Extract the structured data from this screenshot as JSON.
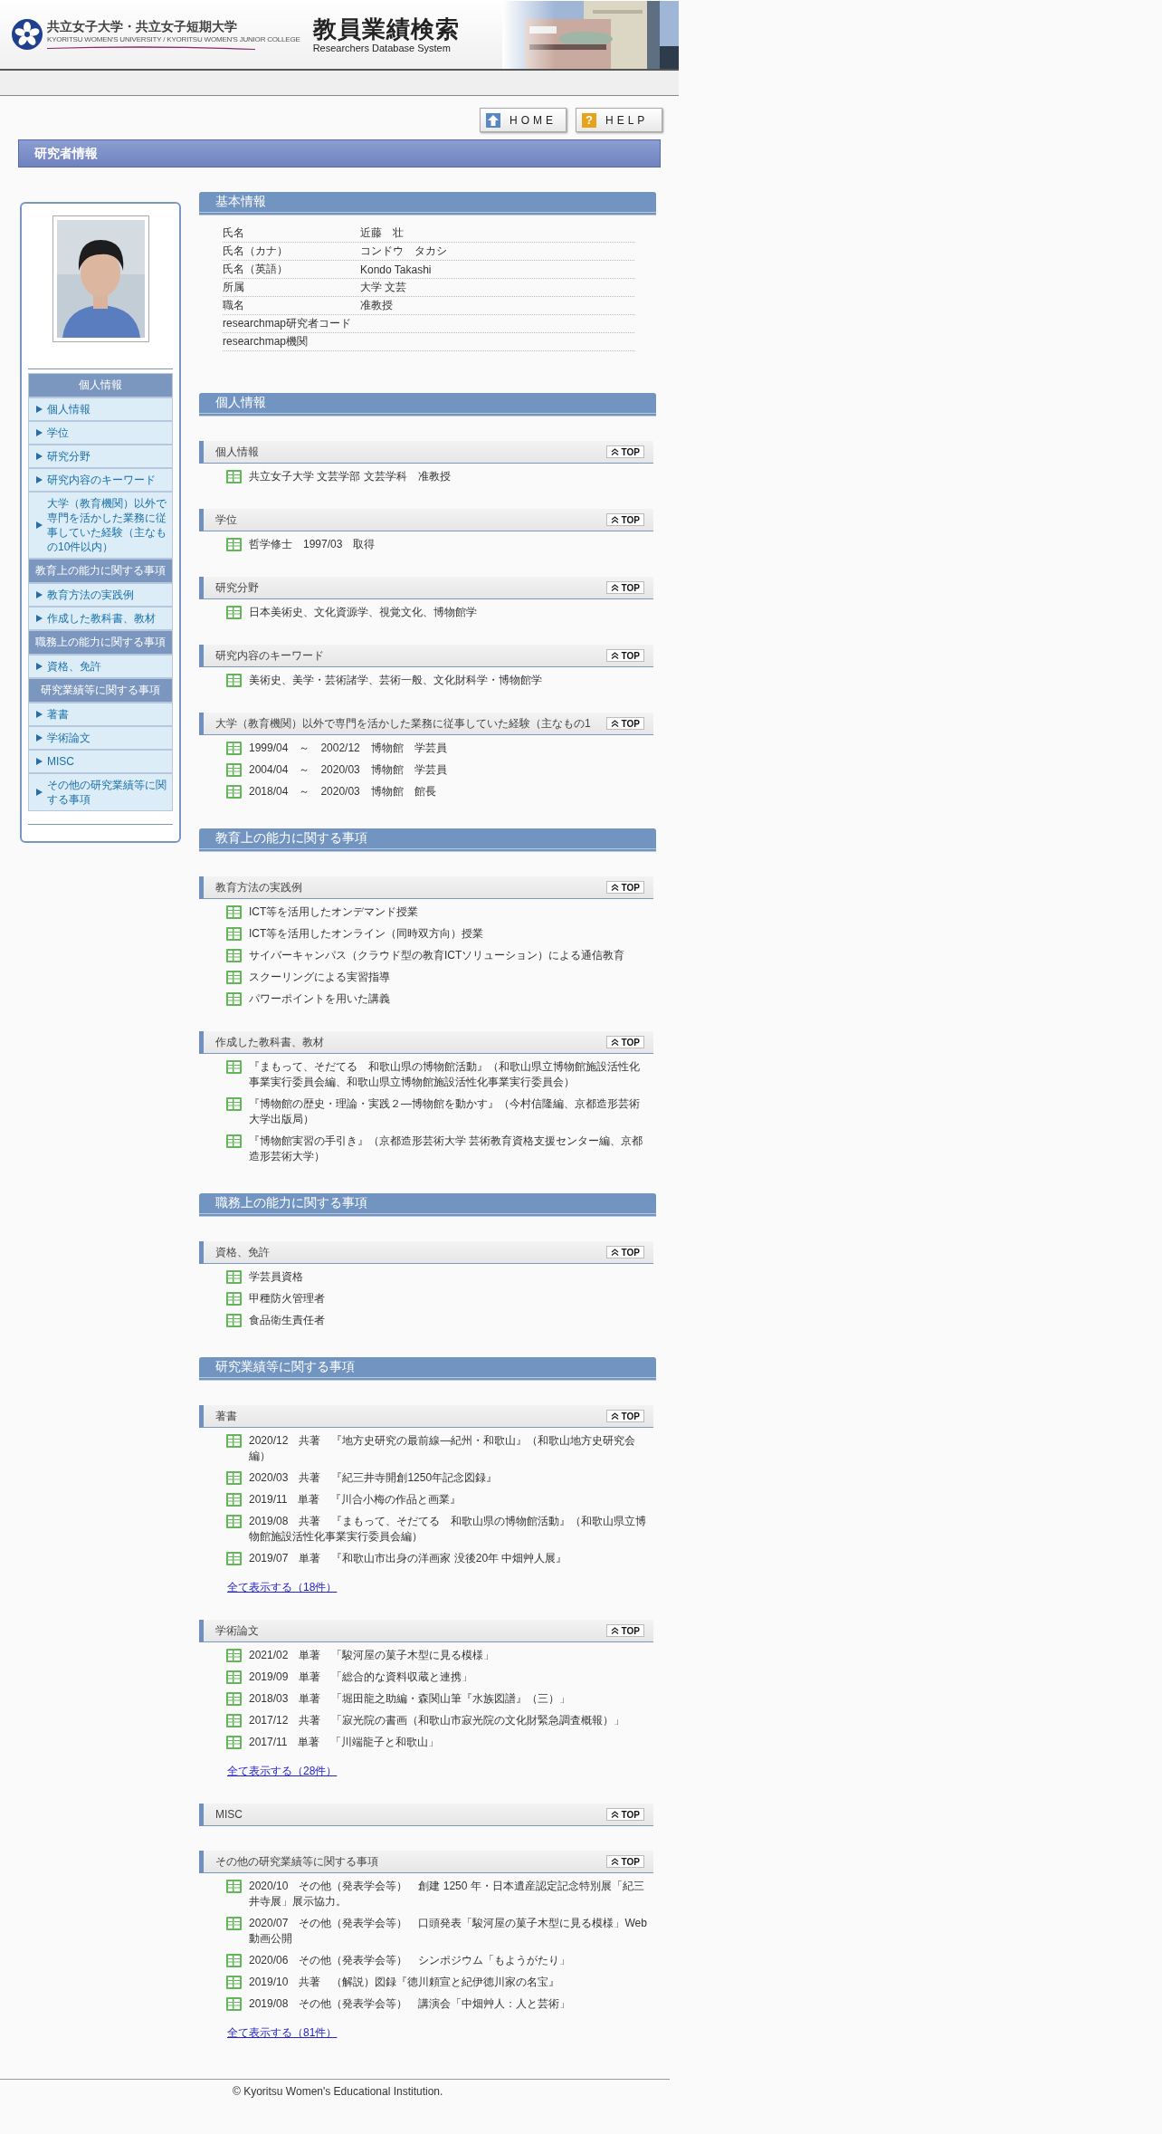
{
  "header": {
    "logo_jp": "共立女子大学・共立女子短期大学",
    "logo_en": "KYORITSU WOMEN'S UNIVERSITY / KYORITSU WOMEN'S JUNIOR COLLEGE",
    "title": "教員業績検索",
    "subtitle": "Researchers Database System"
  },
  "nav_buttons": [
    {
      "kind": "home",
      "label": "HOME"
    },
    {
      "kind": "help",
      "label": "HELP",
      "icon": "?"
    }
  ],
  "page_title": "研究者情報",
  "sidebar": {
    "menu": [
      {
        "kind": "heading",
        "label": "個人情報"
      },
      {
        "kind": "link",
        "label": "個人情報"
      },
      {
        "kind": "link",
        "label": "学位"
      },
      {
        "kind": "link",
        "label": "研究分野"
      },
      {
        "kind": "link",
        "label": "研究内容のキーワード"
      },
      {
        "kind": "link",
        "label": "大学（教育機関）以外で専門を活かした業務に従事していた経験（主なもの10件以内）"
      },
      {
        "kind": "heading",
        "label": "教育上の能力に関する事項"
      },
      {
        "kind": "link",
        "label": "教育方法の実践例"
      },
      {
        "kind": "link",
        "label": "作成した教科書、教材"
      },
      {
        "kind": "heading",
        "label": "職務上の能力に関する事項"
      },
      {
        "kind": "link",
        "label": "資格、免許"
      },
      {
        "kind": "heading",
        "label": "研究業績等に関する事項"
      },
      {
        "kind": "link",
        "label": "著書"
      },
      {
        "kind": "link",
        "label": "学術論文"
      },
      {
        "kind": "link",
        "label": "MISC"
      },
      {
        "kind": "link",
        "label": "その他の研究業績等に関する事項"
      }
    ]
  },
  "basic_info": {
    "title": "基本情報",
    "rows": [
      {
        "label": "氏名",
        "value": "近藤　壮"
      },
      {
        "label": "氏名（カナ）",
        "value": "コンドウ　タカシ"
      },
      {
        "label": "氏名（英語）",
        "value": "Kondo Takashi"
      },
      {
        "label": "所属",
        "value": "大学 文芸"
      },
      {
        "label": "職名",
        "value": "准教授"
      },
      {
        "label": "researchmap研究者コード"
      },
      {
        "label": "researchmap機関"
      }
    ]
  },
  "sections": [
    {
      "title": "個人情報",
      "subsections": [
        {
          "title": "個人情報",
          "top": "TOP",
          "items": [
            "共立女子大学 文芸学部 文芸学科　准教授"
          ]
        },
        {
          "title": "学位",
          "top": "TOP",
          "items": [
            "哲学修士　1997/03　取得"
          ]
        },
        {
          "title": "研究分野",
          "top": "TOP",
          "items": [
            "日本美術史、文化資源学、視覚文化、博物館学"
          ]
        },
        {
          "title": "研究内容のキーワード",
          "top": "TOP",
          "items": [
            "美術史、美学・芸術諸学、芸術一般、文化財科学・博物館学"
          ]
        },
        {
          "title": "大学（教育機関）以外で専門を活かした業務に従事していた経験（主なもの1",
          "top": "TOP",
          "items": [
            "1999/04　～　2002/12　博物館　学芸員",
            "2004/04　～　2020/03　博物館　学芸員",
            "2018/04　～　2020/03　博物館　館長"
          ]
        }
      ]
    },
    {
      "title": "教育上の能力に関する事項",
      "subsections": [
        {
          "title": "教育方法の実践例",
          "top": "TOP",
          "items": [
            "ICT等を活用したオンデマンド授業",
            "ICT等を活用したオンライン（同時双方向）授業",
            "サイバーキャンパス（クラウド型の教育ICTソリューション）による通信教育",
            "スクーリングによる実習指導",
            "パワーポイントを用いた講義"
          ]
        },
        {
          "title": "作成した教科書、教材",
          "top": "TOP",
          "items": [
            "『まもって、そだてる　和歌山県の博物館活動』（和歌山県立博物館施設活性化事業実行委員会編、和歌山県立博物館施設活性化事業実行委員会）",
            "『博物館の歴史・理論・実践２―博物館を動かす』（今村信隆編、京都造形芸術大学出版局）",
            "『博物館実習の手引き』（京都造形芸術大学 芸術教育資格支援センター編、京都造形芸術大学）"
          ]
        }
      ]
    },
    {
      "title": "職務上の能力に関する事項",
      "subsections": [
        {
          "title": "資格、免許",
          "top": "TOP",
          "items": [
            "学芸員資格",
            "甲種防火管理者",
            "食品衛生責任者"
          ]
        }
      ]
    },
    {
      "title": "研究業績等に関する事項",
      "subsections": [
        {
          "title": "著書",
          "top": "TOP",
          "items": [
            "2020/12　共著　『地方史研究の最前線―紀州・和歌山』（和歌山地方史研究会編）",
            "2020/03　共著　『紀三井寺開創1250年記念図録』",
            "2019/11　単著　『川合小梅の作品と画業』",
            "2019/08　共著　『まもって、そだてる　和歌山県の博物館活動』（和歌山県立博物館施設活性化事業実行委員会編）",
            "2019/07　単著　『和歌山市出身の洋画家 没後20年 中畑艸人展』"
          ],
          "more": "全て表示する（18件）"
        },
        {
          "title": "学術論文",
          "top": "TOP",
          "items": [
            "2021/02　単著　「駿河屋の菓子木型に見る模様」",
            "2019/09　単著　「総合的な資料収蔵と連携」",
            "2018/03　単著　「堀田龍之助編・森関山筆『水族図譜』（三）」",
            "2017/12　共著　「寂光院の書画（和歌山市寂光院の文化財緊急調査概報）」",
            "2017/11　単著　「川端龍子と和歌山」"
          ],
          "more": "全て表示する（28件）"
        },
        {
          "title": "MISC",
          "top": "TOP"
        },
        {
          "title": "その他の研究業績等に関する事項",
          "top": "TOP",
          "items": [
            "2020/10　その他（発表学会等）　創建 1250 年・日本遺産認定記念特別展「紀三井寺展」展示協力。",
            "2020/07　その他（発表学会等）　口頭発表「駿河屋の菓子木型に見る模様」Web動画公開",
            "2020/06　その他（発表学会等）　シンポジウム「もようがたり」",
            "2019/10　共著　（解説）図録『徳川頼宣と紀伊徳川家の名宝』",
            "2019/08　その他（発表学会等）　講演会「中畑艸人：人と芸術」"
          ],
          "more": "全て表示する（81件）"
        }
      ]
    }
  ],
  "footer": "© Kyoritsu Women's Educational Institution."
}
